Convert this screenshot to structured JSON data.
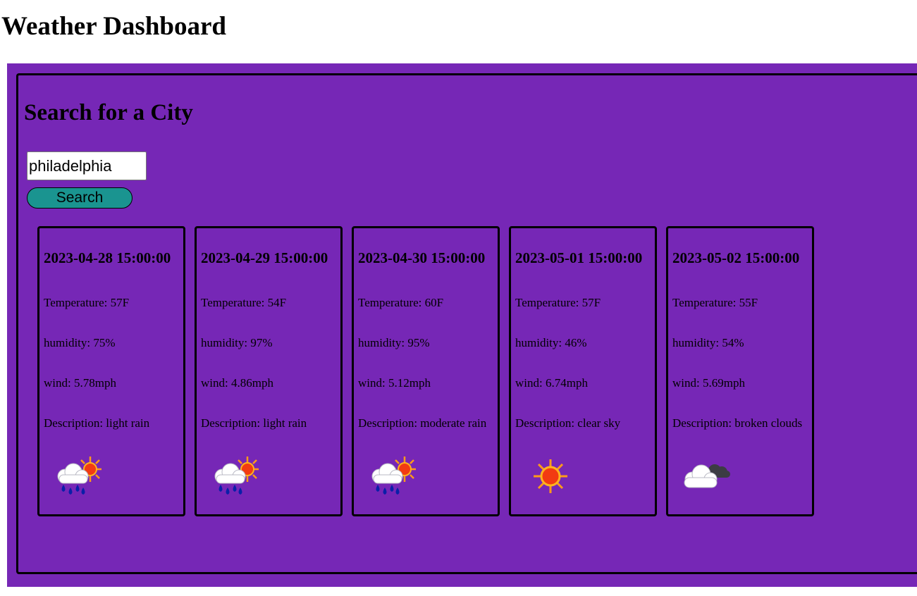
{
  "page": {
    "title": "Weather Dashboard"
  },
  "search": {
    "title": "Search for a City",
    "input_value": "philadelphia",
    "button_label": "Search"
  },
  "colors": {
    "panel_background": "#7627b6",
    "button_background": "#1a9490"
  },
  "forecast": [
    {
      "date": "2023-04-28 15:00:00",
      "temperature": "Temperature: 57F",
      "humidity": "humidity: 75%",
      "wind": "wind: 5.78mph",
      "description": "Description: light rain",
      "icon": "rain-sun-icon"
    },
    {
      "date": "2023-04-29 15:00:00",
      "temperature": "Temperature: 54F",
      "humidity": "humidity: 97%",
      "wind": "wind: 4.86mph",
      "description": "Description: light rain",
      "icon": "rain-sun-icon"
    },
    {
      "date": "2023-04-30 15:00:00",
      "temperature": "Temperature: 60F",
      "humidity": "humidity: 95%",
      "wind": "wind: 5.12mph",
      "description": "Description: moderate rain",
      "icon": "rain-sun-icon"
    },
    {
      "date": "2023-05-01 15:00:00",
      "temperature": "Temperature: 57F",
      "humidity": "humidity: 46%",
      "wind": "wind: 6.74mph",
      "description": "Description: clear sky",
      "icon": "sun-icon"
    },
    {
      "date": "2023-05-02 15:00:00",
      "temperature": "Temperature: 55F",
      "humidity": "humidity: 54%",
      "wind": "wind: 5.69mph",
      "description": "Description: broken clouds",
      "icon": "broken-clouds-icon"
    }
  ]
}
